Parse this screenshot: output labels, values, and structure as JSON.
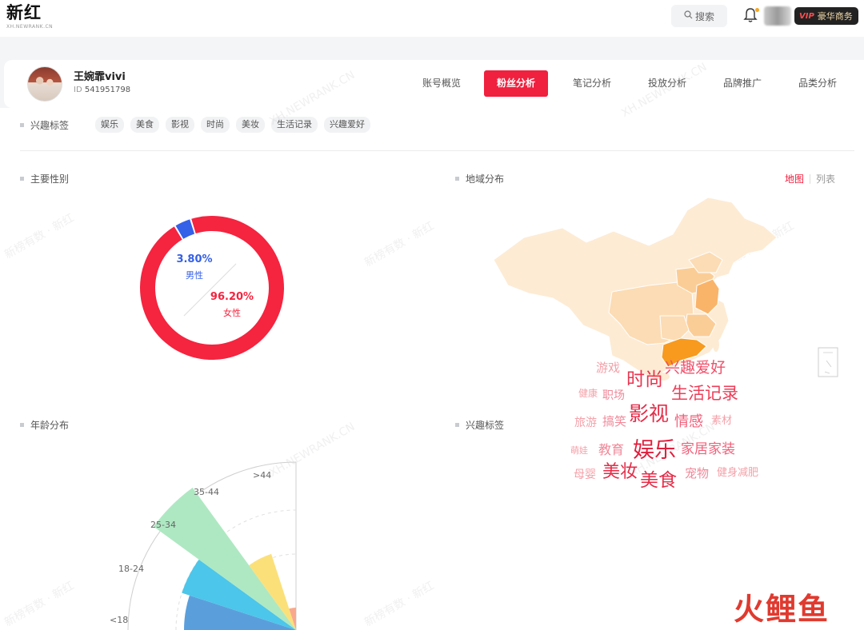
{
  "header": {
    "logo_main": "新红",
    "logo_sub": "XH.NEWRANK.CN",
    "search_label": "搜索",
    "vip_tag": "VIP",
    "vip_label": "豪华商务"
  },
  "profile": {
    "name": "王婉霏vivi",
    "id_prefix": "ID",
    "id": "541951798"
  },
  "nav_tabs": [
    {
      "label": "账号概览",
      "active": false
    },
    {
      "label": "粉丝分析",
      "active": true
    },
    {
      "label": "笔记分析",
      "active": false
    },
    {
      "label": "投放分析",
      "active": false
    },
    {
      "label": "品牌推广",
      "active": false
    },
    {
      "label": "品类分析",
      "active": false
    }
  ],
  "interest_tags": {
    "title": "兴趣标签",
    "tags": [
      "娱乐",
      "美食",
      "影视",
      "时尚",
      "美妆",
      "生活记录",
      "兴趣爱好"
    ]
  },
  "gender": {
    "title": "主要性别",
    "male": {
      "label": "男性",
      "pct": "3.80%",
      "value": 3.8,
      "color": "#3560e8"
    },
    "female": {
      "label": "女性",
      "pct": "96.20%",
      "value": 96.2,
      "color": "#f5243f"
    }
  },
  "region": {
    "title": "地域分布",
    "toggle_map": "地图",
    "toggle_list": "列表"
  },
  "age": {
    "title": "年龄分布"
  },
  "interest_cloud": {
    "title": "兴趣标签",
    "words": [
      {
        "text": "游戏",
        "size": 15,
        "color": "#f4a0a8"
      },
      {
        "text": "兴趣爱好",
        "size": 19,
        "color": "#f0506b"
      },
      {
        "text": "健康",
        "size": 12,
        "color": "#f4a0a8"
      },
      {
        "text": "职场",
        "size": 14,
        "color": "#f08898"
      },
      {
        "text": "时尚",
        "size": 23,
        "color": "#e8344f"
      },
      {
        "text": "生活记录",
        "size": 21,
        "color": "#ec3e58"
      },
      {
        "text": "旅游",
        "size": 14,
        "color": "#f4a0a8"
      },
      {
        "text": "搞笑",
        "size": 15,
        "color": "#f08898"
      },
      {
        "text": "影视",
        "size": 25,
        "color": "#e42c48"
      },
      {
        "text": "情感",
        "size": 18,
        "color": "#f0607a"
      },
      {
        "text": "素材",
        "size": 13,
        "color": "#f4a0a8"
      },
      {
        "text": "萌娃",
        "size": 11,
        "color": "#f4a0a8"
      },
      {
        "text": "教育",
        "size": 16,
        "color": "#f08898"
      },
      {
        "text": "娱乐",
        "size": 27,
        "color": "#e01f3d"
      },
      {
        "text": "家居家装",
        "size": 17,
        "color": "#f0607a"
      },
      {
        "text": "母婴",
        "size": 14,
        "color": "#f4a0a8"
      },
      {
        "text": "美妆",
        "size": 22,
        "color": "#e42c48"
      },
      {
        "text": "美食",
        "size": 23,
        "color": "#e42c48"
      },
      {
        "text": "宠物",
        "size": 15,
        "color": "#f08898"
      },
      {
        "text": "健身减肥",
        "size": 13,
        "color": "#f4a0a8"
      }
    ]
  },
  "chart_data": {
    "type": "pie",
    "categories": [
      "男性",
      "女性"
    ],
    "values": [
      3.8,
      96.2
    ],
    "title": "主要性别"
  },
  "age_chart": {
    "type": "rose",
    "categories": [
      "<18",
      "18-24",
      "25-34",
      "35-44",
      ">44"
    ],
    "colors": [
      "#5a9fdc",
      "#4cc6ea",
      "#aee8c2",
      "#fbe07a",
      "#f9a88d"
    ]
  },
  "watermarks": {
    "site": "XH.NEWRANK.CN",
    "brand": "新榜有数 · 新红"
  },
  "corner_brand": "火鲤鱼"
}
